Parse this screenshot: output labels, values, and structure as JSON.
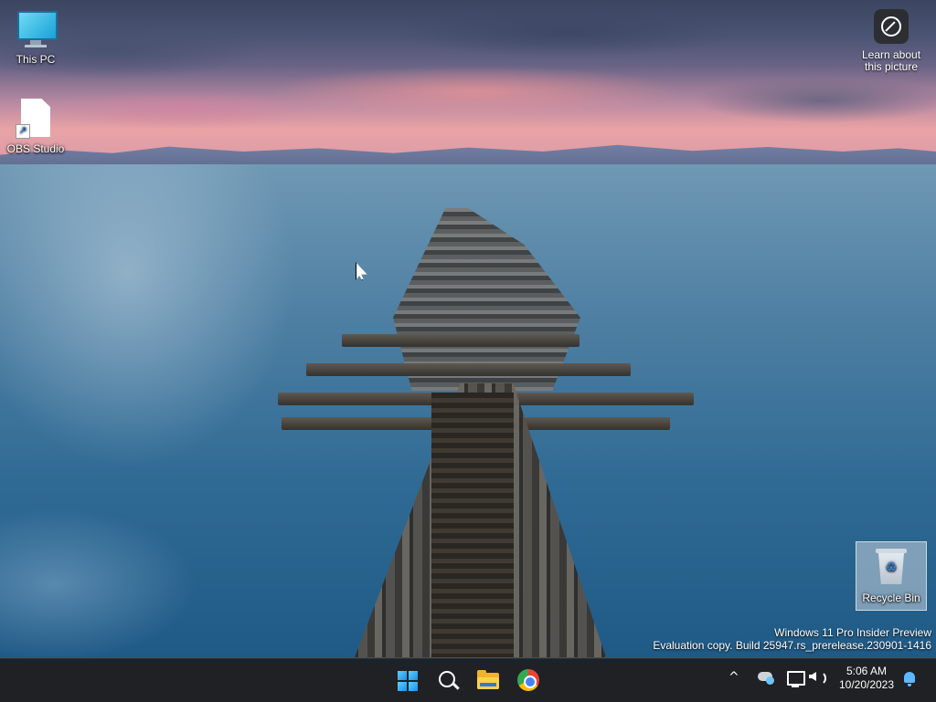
{
  "desktop": {
    "icons": [
      {
        "label": "This PC"
      },
      {
        "label": "OBS Studio"
      },
      {
        "label": "Recycle Bin"
      }
    ],
    "spotlight": {
      "label_line1": "Learn about",
      "label_line2": "this picture"
    },
    "watermark": {
      "line1": "Windows 11 Pro Insider Preview",
      "line2": "Evaluation copy. Build 25947.rs_prerelease.230901-1416"
    }
  },
  "taskbar": {
    "pinned": [
      {
        "name": "start-button",
        "icon": "windows-logo-icon"
      },
      {
        "name": "search-button",
        "icon": "search-icon"
      },
      {
        "name": "file-explorer-button",
        "icon": "folder-icon"
      },
      {
        "name": "chrome-button",
        "icon": "chrome-icon"
      }
    ],
    "tray": {
      "chevron": "^",
      "time": "5:06 AM",
      "date": "10/20/2023"
    }
  },
  "colors": {
    "taskbar_bg": "#202124",
    "accent": "#1c8fe6"
  }
}
